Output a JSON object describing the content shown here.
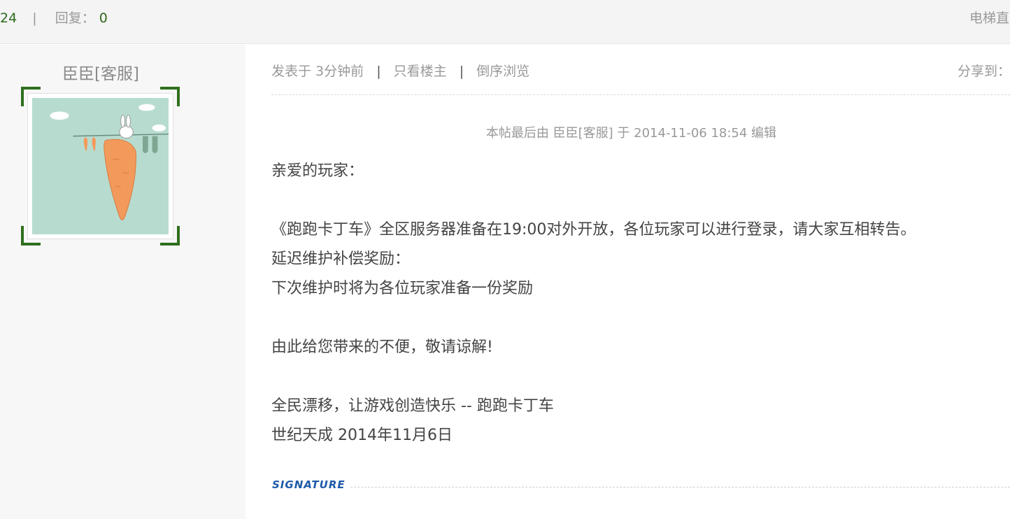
{
  "stats": {
    "views": "24",
    "divider": "|",
    "replies_label": "回复：",
    "replies": "0",
    "lift_label": "电梯直"
  },
  "author": {
    "name": "臣臣[客服]"
  },
  "post": {
    "posted_label": "发表于 3分钟前",
    "only_author": "只看楼主",
    "reverse_view": "倒序浏览",
    "divider": "|",
    "share_label": "分享到：",
    "edit_notice": "本帖最后由 臣臣[客服] 于 2014-11-06 18:54 编辑",
    "lines": [
      "亲爱的玩家：",
      "",
      "《跑跑卡丁车》全区服务器准备在19:00对外开放，各位玩家可以进行登录，请大家互相转告。",
      "延迟维护补偿奖励：",
      "下次维护时将为各位玩家准备一份奖励",
      "",
      "由此给您带来的不便，敬请谅解!",
      "",
      "全民漂移，让游戏创造快乐 -- 跑跑卡丁车",
      "世纪天成 2014年11月6日"
    ],
    "signature_label": "SIGNATURE"
  },
  "colors": {
    "green_accent": "#2f6f1e",
    "muted_text": "#999999",
    "body_text": "#444444",
    "signature_blue": "#1e5aa8"
  },
  "icons": [
    "carrot-bunny-avatar"
  ]
}
